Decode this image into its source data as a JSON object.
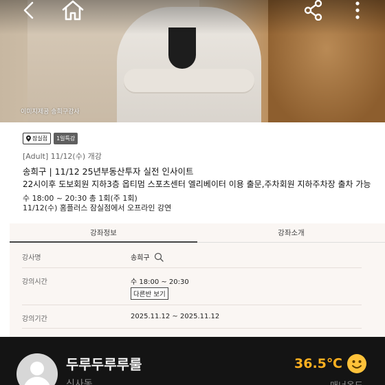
{
  "hero": {
    "credit": "이미지제공 송희구강사"
  },
  "nav": {
    "back_icon": "chevron-left-icon",
    "home_icon": "home-icon",
    "share_icon": "share-icon",
    "more_icon": "more-vertical-icon"
  },
  "badges": {
    "branch": "잠실점",
    "special": "1일특강"
  },
  "lecture": {
    "meta": "[Adult] 11/12(수) 개강",
    "title": "송희구 | 11/12 25년부동산투자 실전 인사이트",
    "subtitle": "22시이후 도보회원 지하3층 옵티멈 스포츠센터 엘리베이터 이용 출문,주차회원 지하주차장 출차 가능",
    "schedule": "수 18:00 ~ 20:30 총 1회(주 1회)",
    "place": "11/12(수) 홈플러스 잠실점에서 오프라인 강연"
  },
  "tabs": [
    {
      "label": "강좌정보",
      "active": true
    },
    {
      "label": "강좌소개",
      "active": false
    }
  ],
  "info": {
    "instructor_label": "강사명",
    "instructor_value": "송희구",
    "time_label": "강의시간",
    "time_value": "수 18:00 ~ 20:30",
    "other_classes_button": "다른반 보기",
    "period_label": "강의기간",
    "period_value": "2025.11.12 ~ 2025.11.12"
  },
  "seller": {
    "nickname": "두루두루루룰",
    "location": "신사동",
    "temperature": "36.5℃",
    "manner_label": "매너온도"
  },
  "colors": {
    "temperature": "#ffb020",
    "seller_bar_bg": "#141414",
    "tab_section_bg": "#faf6f3"
  }
}
